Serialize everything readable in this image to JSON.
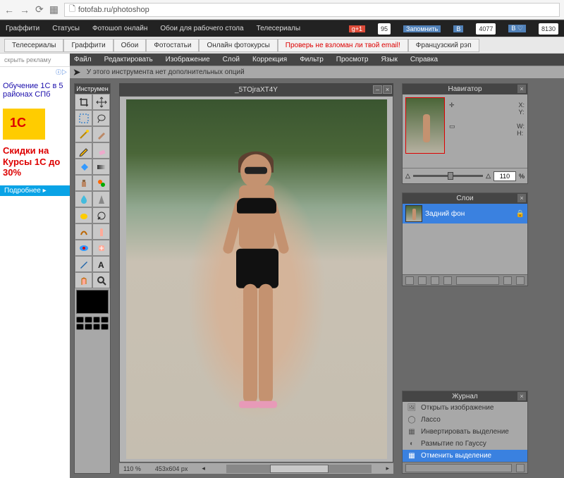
{
  "browser": {
    "url": "fotofab.ru/photoshop"
  },
  "site_nav": {
    "items": [
      "Граффити",
      "Статусы",
      "Фотошоп онлайн",
      "Обои для рабочего стола",
      "Телесериалы"
    ],
    "gplus_count": "95",
    "remember": "Запомнить",
    "vk_count1": "4077",
    "vk_count2": "8130"
  },
  "sub_nav": {
    "items": [
      "Телесериалы",
      "Граффити",
      "Обои",
      "Фотостатьи",
      "Онлайн фотокурсы"
    ],
    "warn": "Проверь не взломан ли твой email!",
    "tail": "Французский рэп"
  },
  "left": {
    "hide": "скрыть рекламу",
    "ad_choice_icon": "▷",
    "ad_head": "Обучение 1С в 5 районах СПб",
    "ad_text": "Скидки на Курсы 1С до 30%",
    "ad_btn": "Подробнее ▸"
  },
  "menu": [
    "Файл",
    "Редактировать",
    "Изображение",
    "Слой",
    "Коррекция",
    "Фильтр",
    "Просмотр",
    "Язык",
    "Справка"
  ],
  "option_bar": "У этого инструмента нет дополнительных опций",
  "toolbox_title": "Инструмен",
  "canvas": {
    "title": "_5TOjraXT4Y",
    "zoom": "110 %",
    "dims": "453x604 px"
  },
  "navigator": {
    "title": "Навигатор",
    "x": "X:",
    "y": "Y:",
    "w": "W:",
    "h": "H:",
    "zoom_value": "110",
    "pct": "%"
  },
  "layers": {
    "title": "Слои",
    "row1": "Задний фон"
  },
  "journal": {
    "title": "Журнал",
    "items": [
      {
        "icon": "🖼",
        "label": "Открыть изображение"
      },
      {
        "icon": "◯",
        "label": "Лассо"
      },
      {
        "icon": "▦",
        "label": "Инвертировать выделение"
      },
      {
        "icon": "◐",
        "label": "Размытие по Гауссу"
      },
      {
        "icon": "▦",
        "label": "Отменить выделение"
      }
    ]
  }
}
